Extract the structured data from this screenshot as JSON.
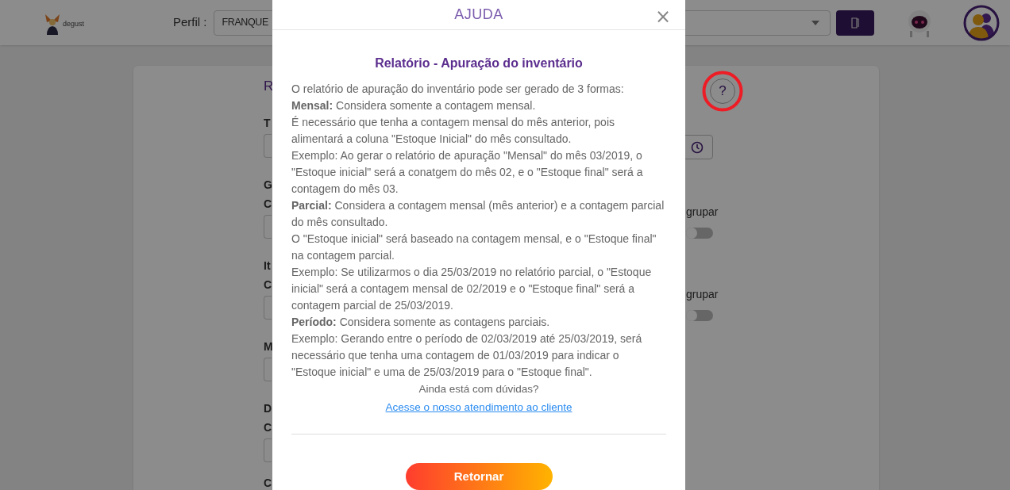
{
  "header": {
    "logo_text": "degust",
    "profile_label": "Perfil :",
    "profile_value": "FRANQUE"
  },
  "page": {
    "title": "R",
    "left_labels": [
      {
        "text": "T",
        "kind": "field"
      },
      {
        "text": "G",
        "kind": "heading"
      },
      {
        "text": "C",
        "kind": "field"
      },
      {
        "text": "It",
        "kind": "heading"
      },
      {
        "text": "C",
        "kind": "field"
      },
      {
        "text": "M",
        "kind": "field"
      },
      {
        "text": "D",
        "kind": "heading"
      },
      {
        "text": "C",
        "kind": "field"
      },
      {
        "text": "C",
        "kind": "label"
      }
    ],
    "help_button": "?",
    "toggles": [
      {
        "label": "grupar",
        "on": false
      },
      {
        "label": "grupar",
        "on": false
      }
    ]
  },
  "modal": {
    "title": "AJUDA",
    "close": "×",
    "heading": "Relatório - Apuração do inventário",
    "paragraphs": [
      "O relatório de apuração do inventário pode ser gerado de 3 formas:",
      "**Mensal:** Considera somente a contagem mensal.",
      "É necessário que tenha a contagem mensal do mês anterior, pois alimentará a coluna \"Estoque Inicial\" do mês consultado.",
      "Exemplo: Ao gerar o relatório de apuração \"Mensal\" do mês 03/2019, o \"Estoque inicial\" será a conatgem do mês 02, e o \"Estoque final\" será a contagem do mês 03.",
      "**Parcial:** Considera a contagem mensal (mês anterior) e a contagem parcial do mês consultado.",
      "O \"Estoque inicial\" será baseado na contagem mensal, e o \"Estoque final\" na contagem parcial.",
      "Exemplo: Se utilizarmos o dia 25/03/2019 no relatório parcial, o \"Estoque inicial\" será a contagem mensal de 02/2019 e o \"Estoque final\" será a contagem parcial de 25/03/2019.",
      "**Período:** Considera somente as contagens parciais.",
      "Exemplo: Gerando entre o período de 02/03/2019 até 25/03/2019, será necessário que tenha uma contagem de 01/03/2019 para indicar o \"Estoque inicial\" e uma de 25/03/2019 para o \"Estoque final\"."
    ],
    "question": "Ainda está com dúvidas?",
    "link": "Acesse o nosso atendimento ao cliente",
    "button": "Retornar"
  }
}
